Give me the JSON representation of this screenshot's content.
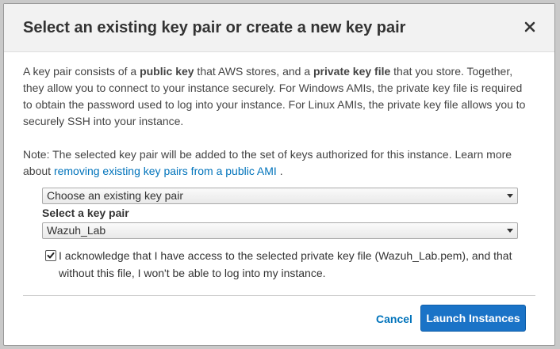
{
  "dialog": {
    "title": "Select an existing key pair or create a new key pair",
    "intro": {
      "p1": "A key pair consists of a ",
      "b1": "public key",
      "p2": " that AWS stores, and a ",
      "b2": "private key file",
      "p3": " that you store. Together, they allow you to connect to your instance securely. For Windows AMIs, the private key file is required to obtain the password used to log into your instance. For Linux AMIs, the private key file allows you to securely SSH into your instance."
    },
    "note": {
      "text": "Note: The selected key pair will be added to the set of keys authorized for this instance. Learn more about ",
      "link": "removing existing key pairs from a public AMI",
      "end": " ."
    },
    "key_pair_option": "Choose an existing key pair",
    "select_label": "Select a key pair",
    "selected_key_pair": "Wazuh_Lab",
    "acknowledge_checked": true,
    "acknowledge_text": "I acknowledge that I have access to the selected private key file (Wazuh_Lab.pem), and that without this file, I won't be able to log into my instance.",
    "cancel_label": "Cancel",
    "launch_label": "Launch Instances"
  },
  "colors": {
    "link": "#0073bb",
    "primary_button": "#1a73c7"
  },
  "icons": {
    "close": "close-icon",
    "checkbox": "check-icon",
    "dropdown": "chevron-down-icon"
  }
}
